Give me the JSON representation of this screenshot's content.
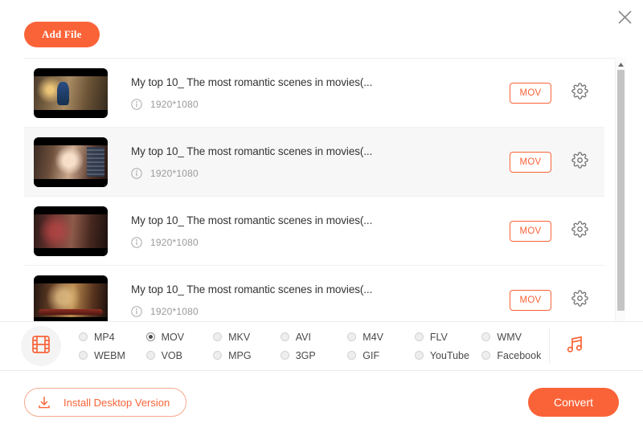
{
  "window": {
    "close_label": "close-icon"
  },
  "toolbar": {
    "add_file_label": "Add File"
  },
  "file_list": {
    "rows": [
      {
        "title": "My top 10_ The most romantic scenes in movies(...",
        "resolution": "1920*1080",
        "format": "MOV"
      },
      {
        "title": "My top 10_ The most romantic scenes in movies(...",
        "resolution": "1920*1080",
        "format": "MOV"
      },
      {
        "title": "My top 10_ The most romantic scenes in movies(...",
        "resolution": "1920*1080",
        "format": "MOV"
      },
      {
        "title": "My top 10_ The most romantic scenes in movies(...",
        "resolution": "1920*1080",
        "format": "MOV"
      }
    ]
  },
  "format_bar": {
    "options": [
      {
        "label": "MP4",
        "selected": false
      },
      {
        "label": "MOV",
        "selected": true
      },
      {
        "label": "MKV",
        "selected": false
      },
      {
        "label": "AVI",
        "selected": false
      },
      {
        "label": "M4V",
        "selected": false
      },
      {
        "label": "FLV",
        "selected": false
      },
      {
        "label": "WMV",
        "selected": false
      },
      {
        "label": "WEBM",
        "selected": false
      },
      {
        "label": "VOB",
        "selected": false
      },
      {
        "label": "MPG",
        "selected": false
      },
      {
        "label": "3GP",
        "selected": false
      },
      {
        "label": "GIF",
        "selected": false
      },
      {
        "label": "YouTube",
        "selected": false
      },
      {
        "label": "Facebook",
        "selected": false
      }
    ],
    "video_icon": "film-strip-icon",
    "audio_icon": "music-note-icon"
  },
  "footer": {
    "install_label": "Install Desktop Version",
    "convert_label": "Convert"
  },
  "colors": {
    "accent": "#FA6338",
    "accent_light": "#f6a98c",
    "row_alt": "#f7f7f7",
    "text": "#333333",
    "muted": "#9a9a9a"
  }
}
